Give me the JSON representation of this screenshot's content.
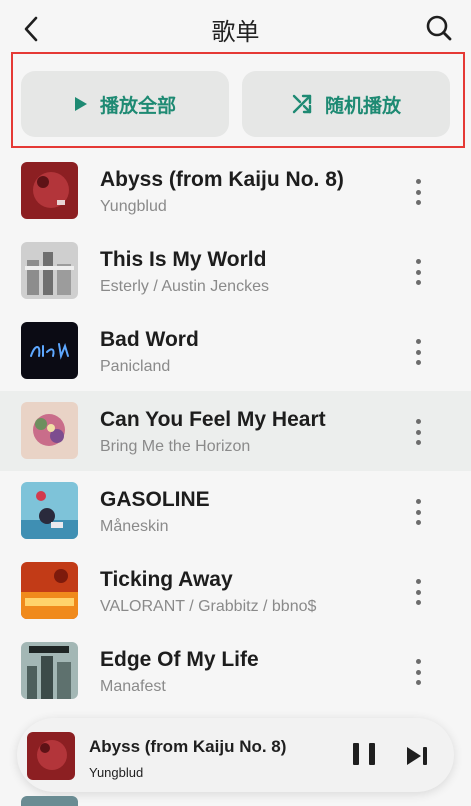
{
  "header": {
    "title": "歌单",
    "back_icon": "chevron-left-icon",
    "search_icon": "search-icon"
  },
  "actions": {
    "play_all_label": "播放全部",
    "shuffle_label": "随机播放",
    "accent_color": "#1e8a73",
    "highlight_frame_color": "#e53935"
  },
  "songs": [
    {
      "title": "Abyss (from Kaiju No. 8)",
      "artist": "Yungblud"
    },
    {
      "title": "This Is My World",
      "artist": "Esterly / Austin Jenckes"
    },
    {
      "title": "Bad Word",
      "artist": "Panicland"
    },
    {
      "title": "Can You Feel My Heart",
      "artist": "Bring Me the Horizon"
    },
    {
      "title": "GASOLINE",
      "artist": "Måneskin"
    },
    {
      "title": "Ticking Away",
      "artist": "VALORANT / Grabbitz / bbno$"
    },
    {
      "title": "Edge Of My Life",
      "artist": "Manafest"
    }
  ],
  "now_playing": {
    "title": "Abyss (from Kaiju No. 8)",
    "artist": "Yungblud",
    "pause_icon": "pause-icon",
    "next_icon": "skip-next-icon"
  }
}
